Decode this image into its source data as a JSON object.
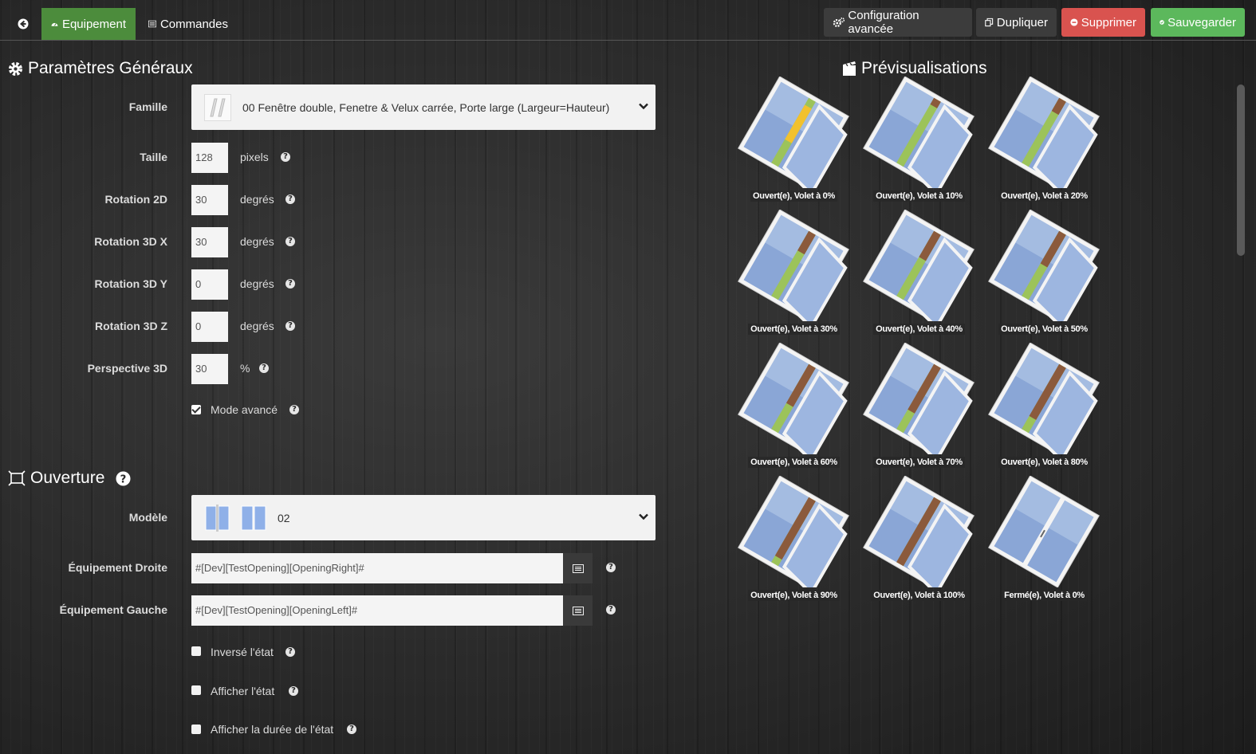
{
  "topbar": {
    "tabs": [
      {
        "label": "Equipement"
      },
      {
        "label": "Commandes"
      }
    ],
    "buttons": {
      "config": "Configuration avancée",
      "duplicate": "Dupliquer",
      "delete": "Supprimer",
      "save": "Sauvegarder"
    }
  },
  "general": {
    "title": "Paramètres Généraux",
    "famille": {
      "label": "Famille",
      "value": "00 Fenêtre double, Fenetre & Velux carrée, Porte large (Largeur=Hauteur)"
    },
    "taille": {
      "label": "Taille",
      "value": "128",
      "unit": "pixels"
    },
    "rotation2d": {
      "label": "Rotation 2D",
      "value": "30",
      "unit": "degrés"
    },
    "rotation3dx": {
      "label": "Rotation 3D X",
      "value": "30",
      "unit": "degrés"
    },
    "rotation3dy": {
      "label": "Rotation 3D Y",
      "value": "0",
      "unit": "degrés"
    },
    "rotation3dz": {
      "label": "Rotation 3D Z",
      "value": "0",
      "unit": "degrés"
    },
    "perspective": {
      "label": "Perspective 3D",
      "value": "30",
      "unit": "%"
    },
    "mode_avance": {
      "label": "Mode avancé",
      "checked": true
    }
  },
  "opening": {
    "title": "Ouverture",
    "modele": {
      "label": "Modèle",
      "value": "02"
    },
    "equip_droite": {
      "label": "Équipement Droite",
      "value": "#[Dev][TestOpening][OpeningRight]#"
    },
    "equip_gauche": {
      "label": "Équipement Gauche",
      "value": "#[Dev][TestOpening][OpeningLeft]#"
    },
    "inverse": {
      "label": "Inversé l'état",
      "checked": false
    },
    "afficher_etat": {
      "label": "Afficher l'état",
      "checked": false
    },
    "afficher_duree": {
      "label": "Afficher la durée de l'état",
      "checked": false
    }
  },
  "previews": {
    "title": "Prévisualisations",
    "items": [
      {
        "caption": "Ouvert(e), Volet à 0%",
        "shutter": 0
      },
      {
        "caption": "Ouvert(e), Volet à 10%",
        "shutter": 10
      },
      {
        "caption": "Ouvert(e), Volet à 20%",
        "shutter": 20
      },
      {
        "caption": "Ouvert(e), Volet à 30%",
        "shutter": 30
      },
      {
        "caption": "Ouvert(e), Volet à 40%",
        "shutter": 40
      },
      {
        "caption": "Ouvert(e), Volet à 50%",
        "shutter": 50
      },
      {
        "caption": "Ouvert(e), Volet à 60%",
        "shutter": 60
      },
      {
        "caption": "Ouvert(e), Volet à 70%",
        "shutter": 70
      },
      {
        "caption": "Ouvert(e), Volet à 80%",
        "shutter": 80
      },
      {
        "caption": "Ouvert(e), Volet à 90%",
        "shutter": 90
      },
      {
        "caption": "Ouvert(e), Volet à 100%",
        "shutter": 100
      },
      {
        "caption": "Fermé(e), Volet à 0%",
        "shutter": 0
      }
    ]
  },
  "colors": {
    "equip_tab": "#4c8c3c",
    "delete": "#d9534f",
    "save": "#5cb85c"
  },
  "icons": [
    "back-icon",
    "dashboard-icon",
    "list-icon",
    "cogs-icon",
    "copy-icon",
    "minus-circle-icon",
    "check-circle-icon",
    "gear-icon",
    "expand-icon",
    "film-icon",
    "help-icon",
    "chevron-down-icon",
    "list-alt-icon"
  ]
}
